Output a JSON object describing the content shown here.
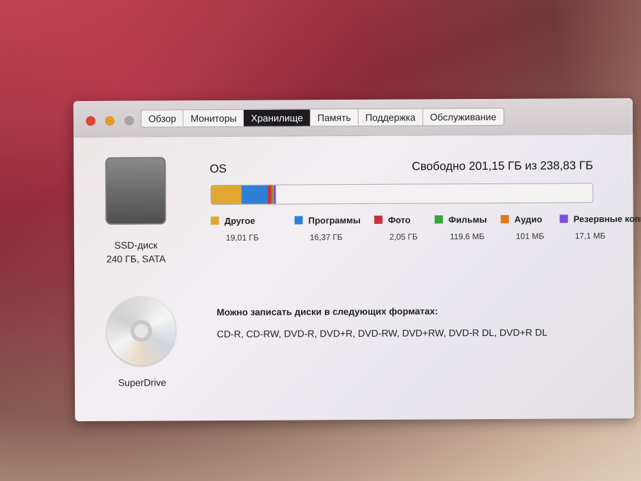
{
  "tabs": [
    "Обзор",
    "Мониторы",
    "Хранилище",
    "Память",
    "Поддержка",
    "Обслуживание"
  ],
  "active_tab": "Хранилище",
  "drives": [
    {
      "name": "SSD-диск",
      "detail": "240 ГБ, SATA"
    },
    {
      "name": "SuperDrive"
    }
  ],
  "volume": {
    "name": "OS",
    "free_text": "Свободно 201,15 ГБ из 238,83 ГБ",
    "total_gb": 238.83,
    "free_gb": 201.15
  },
  "categories": [
    {
      "label": "Другое",
      "size": "19,01 ГБ",
      "gb": 19.01,
      "color": "#e0a830"
    },
    {
      "label": "Программы",
      "size": "16,37 ГБ",
      "gb": 16.37,
      "color": "#2f7fd6"
    },
    {
      "label": "Фото",
      "size": "2,05 ГБ",
      "gb": 2.05,
      "color": "#c8303c"
    },
    {
      "label": "Фильмы",
      "size": "119,6 МБ",
      "gb": 0.1196,
      "color": "#3aa43a"
    },
    {
      "label": "Аудио",
      "size": "101 МБ",
      "gb": 0.101,
      "color": "#e07a20"
    },
    {
      "label": "Резервные копии",
      "size": "17,1 МБ",
      "gb": 0.0171,
      "color": "#7a4fe0"
    }
  ],
  "burn": {
    "heading": "Можно записать диски в следующих форматах:",
    "formats": "CD-R, CD-RW, DVD-R, DVD+R, DVD-RW, DVD+RW, DVD-R DL, DVD+R DL"
  }
}
